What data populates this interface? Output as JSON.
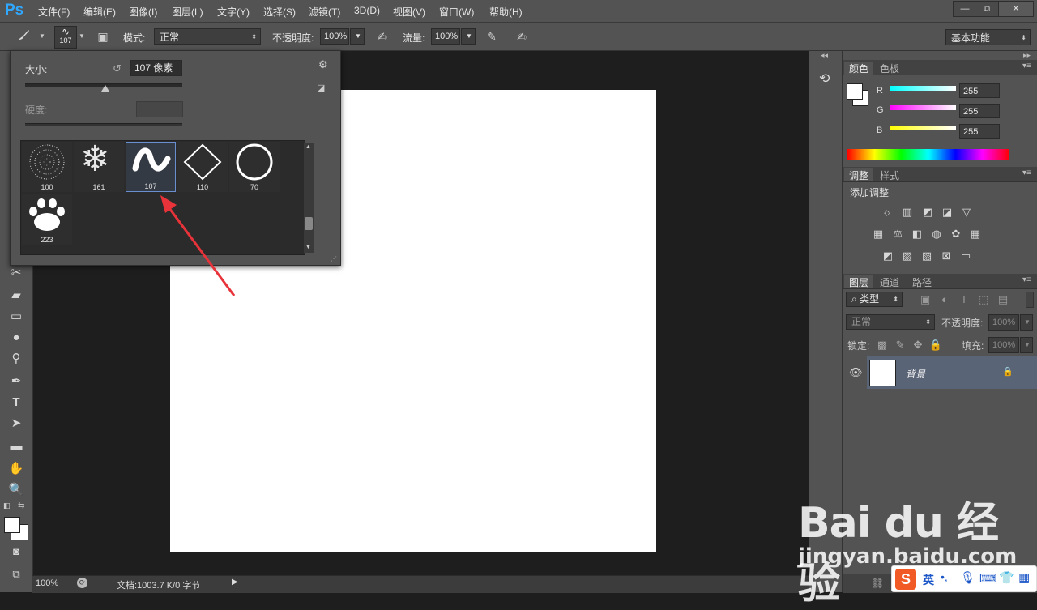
{
  "app": {
    "logo": "Ps",
    "workspace": "基本功能",
    "accent": "#31a8ff"
  },
  "menu": [
    "文件(F)",
    "编辑(E)",
    "图像(I)",
    "图层(L)",
    "文字(Y)",
    "选择(S)",
    "滤镜(T)",
    "3D(D)",
    "视图(V)",
    "窗口(W)",
    "帮助(H)"
  ],
  "window_buttons": [
    "—",
    "⧉",
    "✕"
  ],
  "options": {
    "brush_size": "107",
    "mode_label": "模式:",
    "mode_value": "正常",
    "opacity_label": "不透明度:",
    "opacity_value": "100%",
    "flow_label": "流量:",
    "flow_value": "100%"
  },
  "brush_panel": {
    "size_label": "大小:",
    "size_value": "107 像素",
    "hardness_label": "硬度:",
    "size_slider_fraction": 0.5,
    "presets": [
      {
        "num": "100",
        "icon": "splatter-brush-icon",
        "glyph": "⁘"
      },
      {
        "num": "161",
        "icon": "snowflake-brush-icon",
        "glyph": "❄"
      },
      {
        "num": "107",
        "icon": "wave-brush-icon",
        "glyph": "∿",
        "selected": true
      },
      {
        "num": "110",
        "icon": "diamond-brush-icon",
        "glyph": "◇"
      },
      {
        "num": "70",
        "icon": "circle-brush-icon",
        "glyph": "◯"
      },
      {
        "num": "223",
        "icon": "paw-brush-icon",
        "glyph": "🐾"
      }
    ]
  },
  "color_panel": {
    "tabs": [
      "颜色",
      "色板"
    ],
    "channels": [
      {
        "label": "R",
        "value": "255"
      },
      {
        "label": "G",
        "value": "255"
      },
      {
        "label": "B",
        "value": "255"
      }
    ]
  },
  "adjust_panel": {
    "tabs": [
      "调整",
      "样式"
    ],
    "title": "添加调整"
  },
  "layers_panel": {
    "tabs": [
      "图层",
      "通道",
      "路径"
    ],
    "filter_kind": "类型",
    "blend_mode": "正常",
    "opacity_label": "不透明度:",
    "opacity_value": "100%",
    "lock_label": "锁定:",
    "fill_label": "填充:",
    "fill_value": "100%",
    "layer_name": "背景"
  },
  "status": {
    "zoom": "100%",
    "doc": "文档:1003.7 K/0 字节"
  },
  "watermark": {
    "main": "Bai du 经验",
    "sub": "jingyan.baidu.com"
  },
  "ime": {
    "lang": "英"
  }
}
